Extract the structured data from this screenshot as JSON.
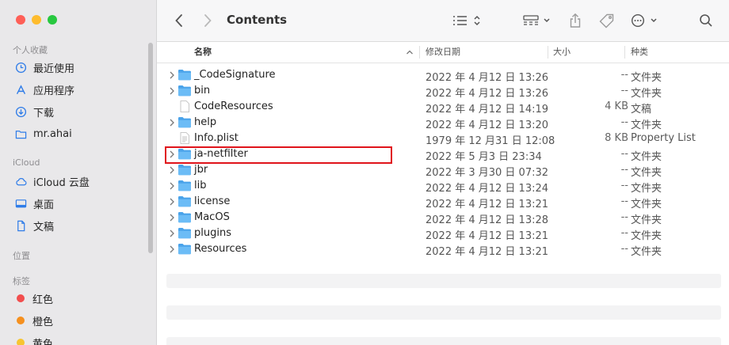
{
  "window": {
    "title": "Contents"
  },
  "sidebar": {
    "favorites_header": "个人收藏",
    "favorites": [
      {
        "label": "最近使用",
        "icon": "clock-icon"
      },
      {
        "label": "应用程序",
        "icon": "applications-icon"
      },
      {
        "label": "下载",
        "icon": "download-icon"
      },
      {
        "label": "mr.ahai",
        "icon": "folder-icon"
      }
    ],
    "icloud_header": "iCloud",
    "icloud": [
      {
        "label": "iCloud 云盘",
        "icon": "cloud-icon"
      },
      {
        "label": "桌面",
        "icon": "desktop-icon"
      },
      {
        "label": "文稿",
        "icon": "document-icon"
      }
    ],
    "locations_header": "位置",
    "tags_header": "标签",
    "tags": [
      {
        "label": "红色",
        "color": "#f24e4e"
      },
      {
        "label": "橙色",
        "color": "#f5901f"
      },
      {
        "label": "黄色",
        "color": "#f7c531"
      }
    ]
  },
  "toolbar": {
    "back_icon": "chevron-left-icon",
    "forward_icon": "chevron-right-icon",
    "list_view_icon": "list-view-icon",
    "grid_view_icon": "gallery-view-icon",
    "share_icon": "share-icon",
    "tag_icon": "tag-icon",
    "more_icon": "ellipsis-circle-icon",
    "search_icon": "search-icon"
  },
  "columns": {
    "name": "名称",
    "date": "修改日期",
    "size": "大小",
    "kind": "种类"
  },
  "files": [
    {
      "name": "_CodeSignature",
      "date": "2022 年 4 月12 日 13:26",
      "size": "--",
      "kind": "文件夹",
      "type": "folder"
    },
    {
      "name": "bin",
      "date": "2022 年 4 月12 日 13:26",
      "size": "--",
      "kind": "文件夹",
      "type": "folder"
    },
    {
      "name": "CodeResources",
      "date": "2022 年 4 月12 日 14:19",
      "size": "4 KB",
      "kind": "文稿",
      "type": "file"
    },
    {
      "name": "help",
      "date": "2022 年 4 月12 日 13:20",
      "size": "--",
      "kind": "文件夹",
      "type": "folder"
    },
    {
      "name": "Info.plist",
      "date": "1979 年 12 月31 日 12:08",
      "size": "8 KB",
      "kind": "Property List",
      "type": "plist"
    },
    {
      "name": "ja-netfilter",
      "date": "2022 年 5 月3 日 23:34",
      "size": "--",
      "kind": "文件夹",
      "type": "folder"
    },
    {
      "name": "jbr",
      "date": "2022 年 3 月30 日 07:32",
      "size": "--",
      "kind": "文件夹",
      "type": "folder"
    },
    {
      "name": "lib",
      "date": "2022 年 4 月12 日 13:24",
      "size": "--",
      "kind": "文件夹",
      "type": "folder"
    },
    {
      "name": "license",
      "date": "2022 年 4 月12 日 13:21",
      "size": "--",
      "kind": "文件夹",
      "type": "folder"
    },
    {
      "name": "MacOS",
      "date": "2022 年 4 月12 日 13:28",
      "size": "--",
      "kind": "文件夹",
      "type": "folder"
    },
    {
      "name": "plugins",
      "date": "2022 年 4 月12 日 13:21",
      "size": "--",
      "kind": "文件夹",
      "type": "folder"
    },
    {
      "name": "Resources",
      "date": "2022 年 4 月12 日 13:21",
      "size": "--",
      "kind": "文件夹",
      "type": "folder"
    }
  ],
  "highlighted_file": "ja-netfilter",
  "highlight_color": "#e0141b",
  "folder_color": "#5aaef0"
}
